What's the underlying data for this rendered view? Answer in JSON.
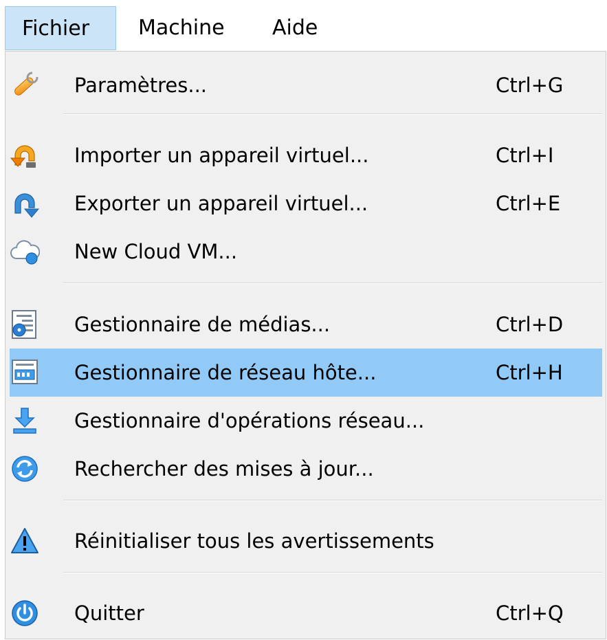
{
  "menubar": {
    "items": [
      {
        "label": "Fichier",
        "active": true
      },
      {
        "label": "Machine",
        "active": false
      },
      {
        "label": "Aide",
        "active": false
      }
    ]
  },
  "menu": {
    "items": [
      {
        "label": "Paramètres...",
        "shortcut": "Ctrl+G",
        "icon": "wrench-icon"
      },
      {
        "label": "Importer un appareil virtuel...",
        "shortcut": "Ctrl+I",
        "icon": "import-appliance-icon"
      },
      {
        "label": "Exporter un appareil virtuel...",
        "shortcut": "Ctrl+E",
        "icon": "export-appliance-icon"
      },
      {
        "label": "New Cloud VM...",
        "shortcut": "",
        "icon": "cloud-icon"
      },
      {
        "label": "Gestionnaire de médias...",
        "shortcut": "Ctrl+D",
        "icon": "media-manager-icon"
      },
      {
        "label": "Gestionnaire de réseau hôte...",
        "shortcut": "Ctrl+H",
        "icon": "network-manager-icon",
        "highlighted": true
      },
      {
        "label": "Gestionnaire d'opérations réseau...",
        "shortcut": "",
        "icon": "download-icon"
      },
      {
        "label": "Rechercher des mises à jour...",
        "shortcut": "",
        "icon": "refresh-icon"
      },
      {
        "label": "Réinitialiser tous les avertissements",
        "shortcut": "",
        "icon": "warning-icon"
      },
      {
        "label": "Quitter",
        "shortcut": "Ctrl+Q",
        "icon": "power-icon"
      }
    ]
  },
  "colors": {
    "highlight": "#91c9f7",
    "menubar_active": "#cce4f7",
    "menu_background": "#f0f0f0"
  }
}
